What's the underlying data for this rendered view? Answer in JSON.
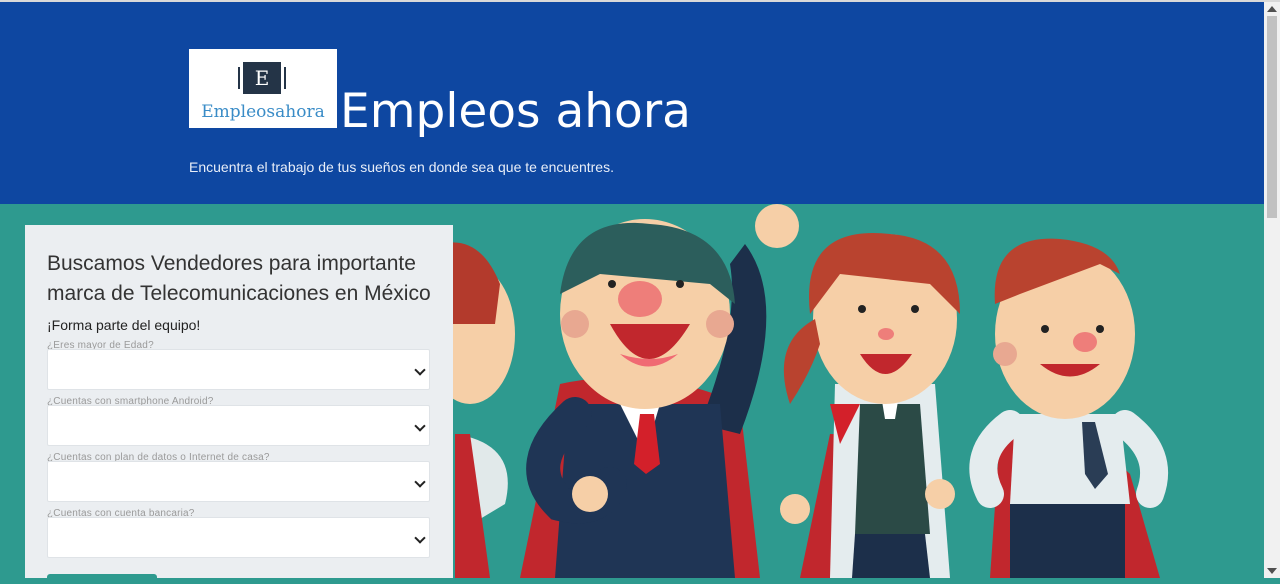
{
  "header": {
    "logo": {
      "mark": "E",
      "text": "Empleosahora"
    },
    "title": "Empleos ahora",
    "tagline": "Encuentra el trabajo de tus sueños en donde sea que te encuentres."
  },
  "form": {
    "title": "Buscamos Vendedores para importante marca de Telecomunicaciones en México",
    "subtitle": "¡Forma parte del equipo!",
    "questions": [
      {
        "label": "¿Eres mayor de Edad?",
        "value": ""
      },
      {
        "label": "¿Cuentas con smartphone Android?",
        "value": ""
      },
      {
        "label": "¿Cuentas con plan de datos o Internet de casa?",
        "value": ""
      },
      {
        "label": "¿Cuentas con cuenta bancaria?",
        "value": ""
      }
    ]
  },
  "colors": {
    "header_bg": "#0e47a1",
    "hero_bg": "#2e9a8f",
    "card_bg": "#ebeef1"
  }
}
